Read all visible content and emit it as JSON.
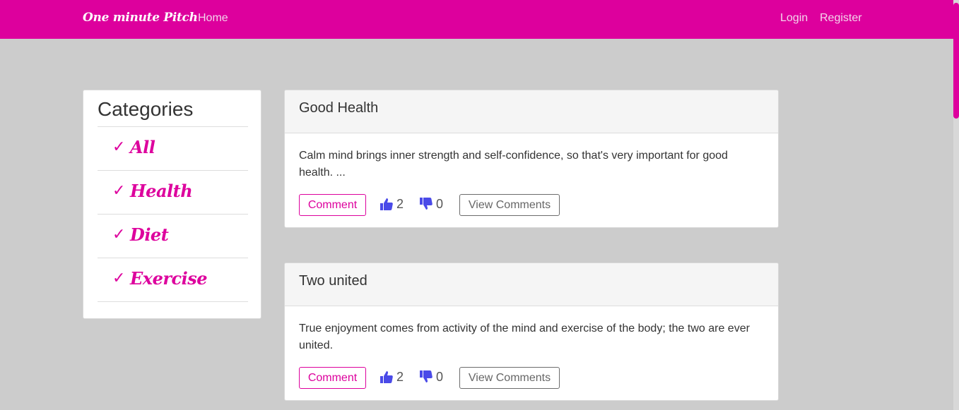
{
  "navbar": {
    "brand": "One minute Pitch",
    "home": "Home",
    "login": "Login",
    "register": "Register",
    "color": "#dd009d"
  },
  "sidebar": {
    "title": "Categories",
    "items": [
      {
        "check": "✓",
        "label": "All"
      },
      {
        "check": "✓",
        "label": "Health"
      },
      {
        "check": "✓",
        "label": "Diet"
      },
      {
        "check": "✓",
        "label": "Exercise"
      }
    ]
  },
  "pitches": [
    {
      "title": "Good Health",
      "body": "Calm mind brings inner strength and self-confidence, so that's very important for good health. ...",
      "comment_label": "Comment",
      "likes": "2",
      "dislikes": "0",
      "view_comments_label": "View Comments"
    },
    {
      "title": "Two united",
      "body": "True enjoyment comes from activity of the mind and exercise of the body; the two are ever united.",
      "comment_label": "Comment",
      "likes": "2",
      "dislikes": "0",
      "view_comments_label": "View Comments"
    }
  ],
  "icons": {
    "like": "thumbs-up-icon",
    "dislike": "thumbs-down-icon",
    "icon_color": "#4a4ae8"
  }
}
